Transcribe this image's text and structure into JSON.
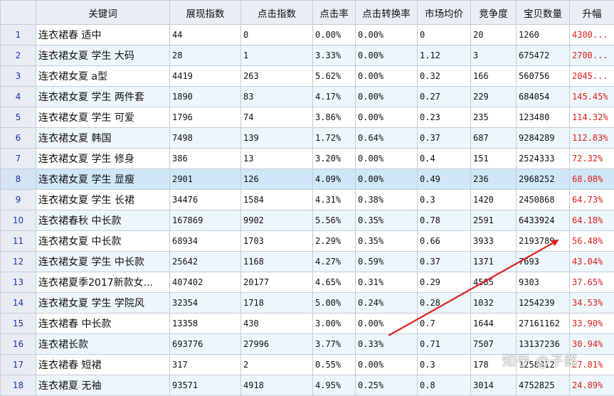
{
  "columns": [
    "关键词",
    "展现指数",
    "点击指数",
    "点击率",
    "点击转换率",
    "市场均价",
    "竞争度",
    "宝贝数量",
    "升幅"
  ],
  "rows": [
    {
      "n": "1",
      "kw": "连衣裙春 适中",
      "imp": "44",
      "clk": "0",
      "ctr": "0.00%",
      "cvr": "0.00%",
      "price": "0",
      "comp": "20",
      "items": "1260",
      "rise": "4300..."
    },
    {
      "n": "2",
      "kw": "连衣裙女夏 学生 大码",
      "imp": "28",
      "clk": "1",
      "ctr": "3.33%",
      "cvr": "0.00%",
      "price": "1.12",
      "comp": "3",
      "items": "675472",
      "rise": "2700..."
    },
    {
      "n": "3",
      "kw": "连衣裙女夏 a型",
      "imp": "4419",
      "clk": "263",
      "ctr": "5.62%",
      "cvr": "0.00%",
      "price": "0.32",
      "comp": "166",
      "items": "560756",
      "rise": "2045..."
    },
    {
      "n": "4",
      "kw": "连衣裙女夏 学生 两件套",
      "imp": "1890",
      "clk": "83",
      "ctr": "4.17%",
      "cvr": "0.00%",
      "price": "0.27",
      "comp": "229",
      "items": "684054",
      "rise": "145.45%"
    },
    {
      "n": "5",
      "kw": "连衣裙女夏 学生 可爱",
      "imp": "1796",
      "clk": "74",
      "ctr": "3.86%",
      "cvr": "0.00%",
      "price": "0.23",
      "comp": "235",
      "items": "123480",
      "rise": "114.32%"
    },
    {
      "n": "6",
      "kw": "连衣裙女夏 韩国",
      "imp": "7498",
      "clk": "139",
      "ctr": "1.72%",
      "cvr": "0.64%",
      "price": "0.37",
      "comp": "687",
      "items": "9284289",
      "rise": "112.83%"
    },
    {
      "n": "7",
      "kw": "连衣裙女夏 学生 修身",
      "imp": "386",
      "clk": "13",
      "ctr": "3.20%",
      "cvr": "0.00%",
      "price": "0.4",
      "comp": "151",
      "items": "2524333",
      "rise": "72.32%"
    },
    {
      "n": "8",
      "kw": "连衣裙女夏 学生 显瘦",
      "imp": "2901",
      "clk": "126",
      "ctr": "4.09%",
      "cvr": "0.00%",
      "price": "0.49",
      "comp": "236",
      "items": "2968252",
      "rise": "68.08%"
    },
    {
      "n": "9",
      "kw": "连衣裙女夏 学生 长裙",
      "imp": "34476",
      "clk": "1584",
      "ctr": "4.31%",
      "cvr": "0.38%",
      "price": "0.3",
      "comp": "1420",
      "items": "2450868",
      "rise": "64.73%"
    },
    {
      "n": "10",
      "kw": "连衣裙春秋 中长款",
      "imp": "167869",
      "clk": "9902",
      "ctr": "5.56%",
      "cvr": "0.35%",
      "price": "0.78",
      "comp": "2591",
      "items": "6433924",
      "rise": "64.18%"
    },
    {
      "n": "11",
      "kw": "连衣裙女夏 中长款",
      "imp": "68934",
      "clk": "1703",
      "ctr": "2.29%",
      "cvr": "0.35%",
      "price": "0.66",
      "comp": "3933",
      "items": "2193789",
      "rise": "56.48%"
    },
    {
      "n": "12",
      "kw": "连衣裙女夏 学生 中长款",
      "imp": "25642",
      "clk": "1168",
      "ctr": "4.27%",
      "cvr": "0.59%",
      "price": "0.37",
      "comp": "1371",
      "items": "7693",
      "rise": "43.04%"
    },
    {
      "n": "13",
      "kw": "连衣裙夏季2017新款女...",
      "imp": "407402",
      "clk": "20177",
      "ctr": "4.65%",
      "cvr": "0.31%",
      "price": "0.29",
      "comp": "4585",
      "items": "9303",
      "rise": "37.65%"
    },
    {
      "n": "14",
      "kw": "连衣裙女夏 学生 学院风",
      "imp": "32354",
      "clk": "1718",
      "ctr": "5.00%",
      "cvr": "0.24%",
      "price": "0.28",
      "comp": "1032",
      "items": "1254239",
      "rise": "34.53%"
    },
    {
      "n": "15",
      "kw": "连衣裙春 中长款",
      "imp": "13358",
      "clk": "430",
      "ctr": "3.00%",
      "cvr": "0.00%",
      "price": "0.7",
      "comp": "1644",
      "items": "27161162",
      "rise": "33.90%"
    },
    {
      "n": "16",
      "kw": "连衣裙长款",
      "imp": "693776",
      "clk": "27996",
      "ctr": "3.77%",
      "cvr": "0.33%",
      "price": "0.71",
      "comp": "7507",
      "items": "13137236",
      "rise": "30.94%"
    },
    {
      "n": "17",
      "kw": "连衣裙春 短裙",
      "imp": "317",
      "clk": "2",
      "ctr": "0.55%",
      "cvr": "0.00%",
      "price": "0.3",
      "comp": "178",
      "items": "1258912",
      "rise": "27.81%"
    },
    {
      "n": "18",
      "kw": "连衣裙夏 无袖",
      "imp": "93571",
      "clk": "4918",
      "ctr": "4.95%",
      "cvr": "0.25%",
      "price": "0.8",
      "comp": "3014",
      "items": "4752825",
      "rise": "24.89%"
    }
  ],
  "watermark": "知乎 @子路",
  "colors": {
    "header_bg": "#e9eef4",
    "alt_row": "#edf6fb",
    "selected_row": "#cfe7f7",
    "rise_text": "#e0201c",
    "index_text": "#1c2fb0",
    "arrow": "#e02020"
  }
}
